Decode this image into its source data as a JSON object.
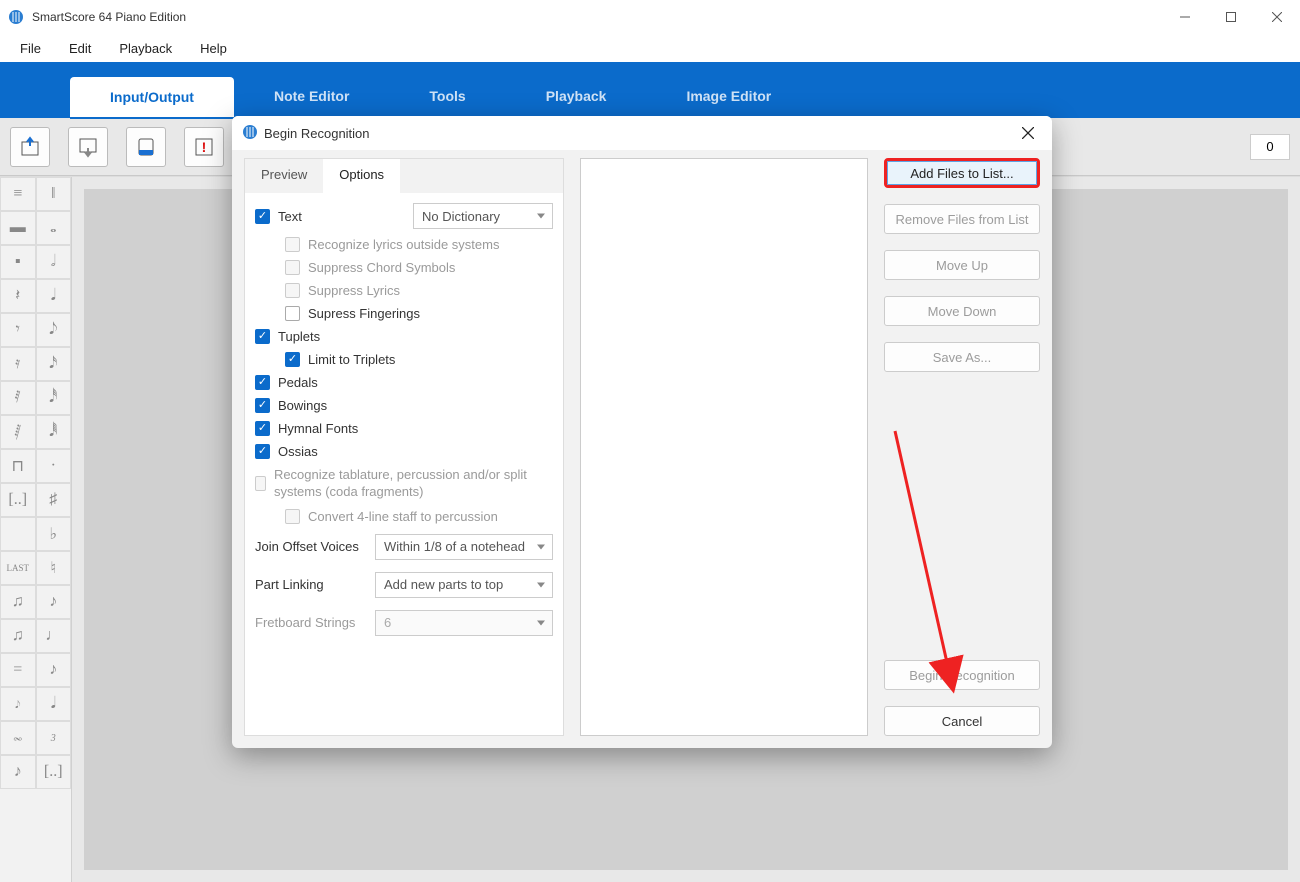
{
  "window": {
    "title": "SmartScore 64 Piano Edition"
  },
  "menu": [
    "File",
    "Edit",
    "Playback",
    "Help"
  ],
  "ribbon_tabs": [
    "Input/Output",
    "Note Editor",
    "Tools",
    "Playback",
    "Image Editor"
  ],
  "ribbon_active": "Input/Output",
  "toolbar": {
    "counter": "0"
  },
  "dialog": {
    "title": "Begin Recognition",
    "tabs": {
      "preview": "Preview",
      "options": "Options",
      "active": "Options"
    },
    "options": {
      "text_label": "Text",
      "dictionary": "No Dictionary",
      "recognize_lyrics": "Recognize lyrics outside systems",
      "suppress_chords": "Suppress Chord Symbols",
      "suppress_lyrics": "Suppress Lyrics",
      "suppress_fingerings": "Supress Fingerings",
      "tuplets": "Tuplets",
      "limit_triplets": "Limit to Triplets",
      "pedals": "Pedals",
      "bowings": "Bowings",
      "hymnal_fonts": "Hymnal Fonts",
      "ossias": "Ossias",
      "recognize_tablature": "Recognize tablature, percussion and/or split systems (coda fragments)",
      "convert_4line": "Convert 4-line staff to percussion",
      "join_offset_label": "Join Offset Voices",
      "join_offset_value": "Within 1/8 of a notehead",
      "part_linking_label": "Part Linking",
      "part_linking_value": "Add new parts to top",
      "fretboard_label": "Fretboard Strings",
      "fretboard_value": "6"
    },
    "buttons": {
      "add_files": "Add Files to List...",
      "remove_files": "Remove Files from List",
      "move_up": "Move Up",
      "move_down": "Move Down",
      "save_as": "Save As...",
      "begin": "Begin Recognition",
      "cancel": "Cancel"
    }
  }
}
